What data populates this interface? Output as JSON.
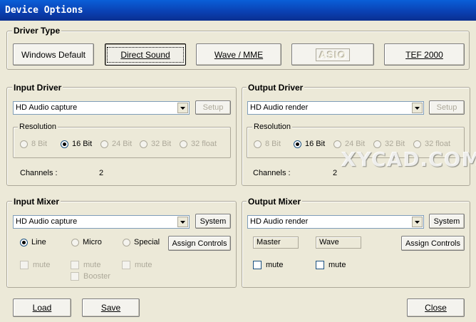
{
  "window": {
    "title": "Device Options"
  },
  "driver_type": {
    "label": "Driver Type",
    "buttons": [
      "Windows Default",
      "Direct Sound",
      "Wave / MME",
      "ASIO",
      "TEF 2000"
    ]
  },
  "input_driver": {
    "label": "Input Driver",
    "device": "HD Audio capture",
    "setup_label": "Setup",
    "resolution_label": "Resolution",
    "resolutions": [
      "8 Bit",
      "16 Bit",
      "24 Bit",
      "32 Bit",
      "32 float"
    ],
    "channels_label": "Channels :",
    "channels_value": "2"
  },
  "output_driver": {
    "label": "Output Driver",
    "device": "HD Audio render",
    "setup_label": "Setup",
    "resolution_label": "Resolution",
    "resolutions": [
      "8 Bit",
      "16 Bit",
      "24 Bit",
      "32 Bit",
      "32 float"
    ],
    "channels_label": "Channels :",
    "channels_value": "2"
  },
  "input_mixer": {
    "label": "Input Mixer",
    "device": "HD Audio capture",
    "system_label": "System",
    "sources": [
      "Line",
      "Micro",
      "Special"
    ],
    "assign_label": "Assign Controls",
    "mute_label": "mute",
    "booster_label": "Booster"
  },
  "output_mixer": {
    "label": "Output Mixer",
    "device": "HD Audio render",
    "system_label": "System",
    "master_label": "Master",
    "wave_label": "Wave",
    "assign_label": "Assign Controls",
    "mute_label": "mute"
  },
  "footer": {
    "load_label": "Load",
    "save_label": "Save",
    "close_label": "Close"
  },
  "watermark": "XYCAD.COM"
}
